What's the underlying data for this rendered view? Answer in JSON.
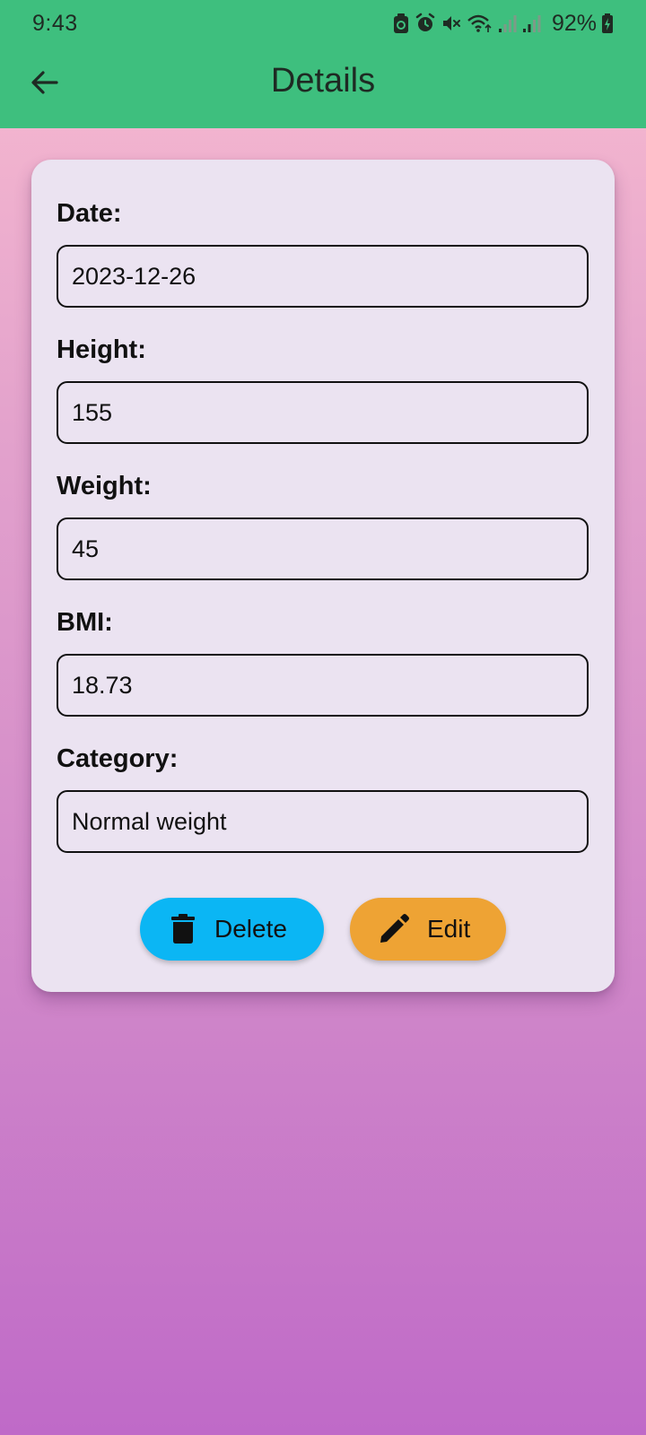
{
  "status_bar": {
    "time": "9:43",
    "battery": "92%",
    "icons": [
      "android-icon",
      "alarm-icon",
      "mute-icon",
      "wifi-icon",
      "signal-icon",
      "signal-icon",
      "battery-icon"
    ]
  },
  "header": {
    "title": "Details",
    "back_icon": "arrow-back-icon"
  },
  "details": {
    "date_label": "Date:",
    "date_value": "2023-12-26",
    "height_label": "Height:",
    "height_value": "155",
    "weight_label": "Weight:",
    "weight_value": "45",
    "bmi_label": "BMI:",
    "bmi_value": "18.73",
    "category_label": "Category:",
    "category_value": "Normal weight"
  },
  "actions": {
    "delete_label": "Delete",
    "delete_icon": "trash-icon",
    "edit_label": "Edit",
    "edit_icon": "pencil-icon"
  },
  "colors": {
    "appbar": "#3ebf7e",
    "card": "#ebe3f1",
    "delete_button": "#0bb6f4",
    "edit_button": "#eea334",
    "gradient_top": "#f8bbd0",
    "gradient_bottom": "#bf6ac8"
  }
}
